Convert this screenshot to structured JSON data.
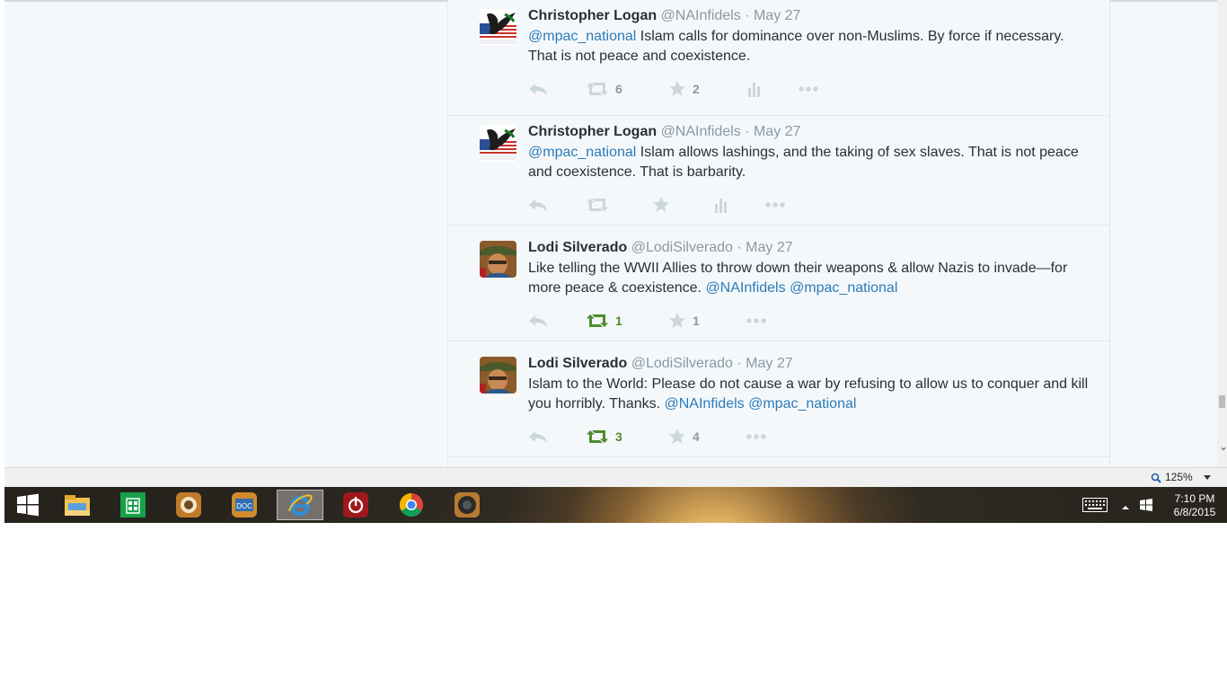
{
  "tweets": [
    {
      "fullname": "Christopher Logan",
      "handle": "@NAInfidels",
      "dot": "·",
      "time": "May 27",
      "text": [
        {
          "t": "@mpac_national",
          "m": true
        },
        {
          "t": " Islam calls for dominance over non-Muslims. By force if necessary. That is not peace and coexistence.",
          "m": false
        }
      ],
      "retweet_count": "6",
      "favorite_count": "2",
      "retweeted": false,
      "has_analytics": true
    },
    {
      "fullname": "Christopher Logan",
      "handle": "@NAInfidels",
      "dot": "·",
      "time": "May 27",
      "text": [
        {
          "t": "@mpac_national",
          "m": true
        },
        {
          "t": " Islam allows lashings, and the taking of sex slaves. That is not peace and coexistence. That is barbarity.",
          "m": false
        }
      ],
      "retweet_count": "",
      "favorite_count": "",
      "retweeted": false,
      "has_analytics": true
    },
    {
      "fullname": "Lodi Silverado",
      "handle": "@LodiSilverado",
      "dot": "·",
      "time": "May 27",
      "text": [
        {
          "t": "Like telling the WWII Allies to throw down their weapons & allow Nazis to invade—for more peace & coexistence. ",
          "m": false
        },
        {
          "t": "@NAInfidels",
          "m": true
        },
        {
          "t": " ",
          "m": false
        },
        {
          "t": "@mpac_national",
          "m": true
        }
      ],
      "retweet_count": "1",
      "favorite_count": "1",
      "retweeted": true,
      "has_analytics": false
    },
    {
      "fullname": "Lodi Silverado",
      "handle": "@LodiSilverado",
      "dot": "·",
      "time": "May 27",
      "text": [
        {
          "t": "Islam to the World: Please do not cause a war by refusing to allow us to conquer and kill you horribly. Thanks. ",
          "m": false
        },
        {
          "t": "@NAInfidels",
          "m": true
        },
        {
          "t": " ",
          "m": false
        },
        {
          "t": "@mpac_national",
          "m": true
        }
      ],
      "retweet_count": "3",
      "favorite_count": "4",
      "retweeted": true,
      "has_analytics": false
    }
  ],
  "zoom": {
    "level": "125%"
  },
  "taskbar": {
    "apps": [
      "start-icon",
      "file-explorer-icon",
      "store-icon",
      "media-app-icon",
      "doc-app-icon",
      "internet-explorer-icon",
      "power-app-icon",
      "chrome-icon",
      "speaker-app-icon"
    ],
    "active_app": "internet-explorer-icon"
  },
  "clock": {
    "time": "7:10 PM",
    "date": "6/8/2015"
  },
  "colors": {
    "link": "#2b7bb9",
    "retweeted": "#4d8c2e",
    "muted": "#8899a6",
    "text": "#292f33"
  }
}
